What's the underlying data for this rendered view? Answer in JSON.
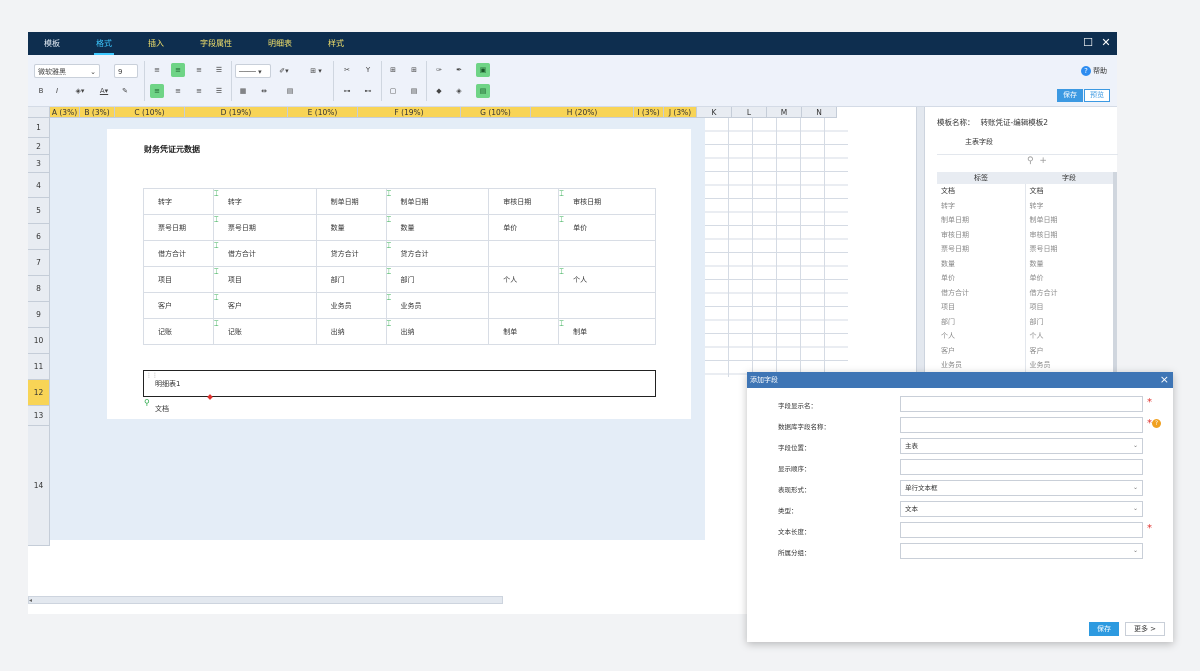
{
  "menu": {
    "items": [
      "模板",
      "格式",
      "插入",
      "字段属性",
      "明细表",
      "样式"
    ],
    "active": "格式"
  },
  "toolbar": {
    "font_name": "微软雅黑",
    "font_size": "9",
    "help_label": "帮助",
    "save_label": "保存",
    "preview_label": "预览"
  },
  "sheet": {
    "columns": [
      "A (3%)",
      "B (3%)",
      "C (10%)",
      "D (19%)",
      "E (10%)",
      "F (19%)",
      "G (10%)",
      "H (20%)",
      "I (3%)",
      "J (3%)",
      "K",
      "L",
      "M",
      "N"
    ],
    "rows": [
      "1",
      "2",
      "3",
      "4",
      "5",
      "6",
      "7",
      "8",
      "9",
      "10",
      "11",
      "12",
      "13",
      "14"
    ],
    "selected_row": "12",
    "doc_title": "财务凭证元数据",
    "table": [
      [
        "转字",
        "转字",
        "制单日期",
        "制单日期",
        "审核日期",
        "审核日期"
      ],
      [
        "票号日期",
        "票号日期",
        "数量",
        "数量",
        "单价",
        "单价"
      ],
      [
        "借方合计",
        "借方合计",
        "贷方合计",
        "贷方合计",
        "",
        ""
      ],
      [
        "项目",
        "项目",
        "部门",
        "部门",
        "个人",
        "个人"
      ],
      [
        "客户",
        "客户",
        "业务员",
        "业务员",
        "",
        ""
      ],
      [
        "记账",
        "记账",
        "出纳",
        "出纳",
        "制单",
        "制单"
      ]
    ],
    "detail_label": "明细表1",
    "doc_label": "文档"
  },
  "right_panel": {
    "template_label": "模板名称：",
    "template_name": "转账凭证-编辑模板2",
    "section": "主表字段",
    "col_tag": "标签",
    "col_field": "字段",
    "fields": [
      [
        "文档",
        "文档"
      ],
      [
        "转字",
        "转字"
      ],
      [
        "制单日期",
        "制单日期"
      ],
      [
        "审核日期",
        "审核日期"
      ],
      [
        "票号日期",
        "票号日期"
      ],
      [
        "数量",
        "数量"
      ],
      [
        "单价",
        "单价"
      ],
      [
        "借方合计",
        "借方合计"
      ],
      [
        "项目",
        "项目"
      ],
      [
        "部门",
        "部门"
      ],
      [
        "个人",
        "个人"
      ],
      [
        "客户",
        "客户"
      ],
      [
        "业务员",
        "业务员"
      ]
    ]
  },
  "dialog": {
    "title": "添加字段",
    "fields": [
      {
        "label": "字段显示名：",
        "value": "",
        "required": true
      },
      {
        "label": "数据库字段名称：",
        "value": "",
        "required": true,
        "help": true
      },
      {
        "label": "字段位置：",
        "value": "主表",
        "select": true
      },
      {
        "label": "显示顺序：",
        "value": ""
      },
      {
        "label": "表现形式：",
        "value": "单行文本框",
        "select": true
      },
      {
        "label": "类型：",
        "value": "文本",
        "select": true
      },
      {
        "label": "文本长度：",
        "value": "",
        "required": true
      },
      {
        "label": "所属分组：",
        "value": "",
        "select": true
      }
    ],
    "save_label": "保存",
    "more_label": "更多 >"
  }
}
